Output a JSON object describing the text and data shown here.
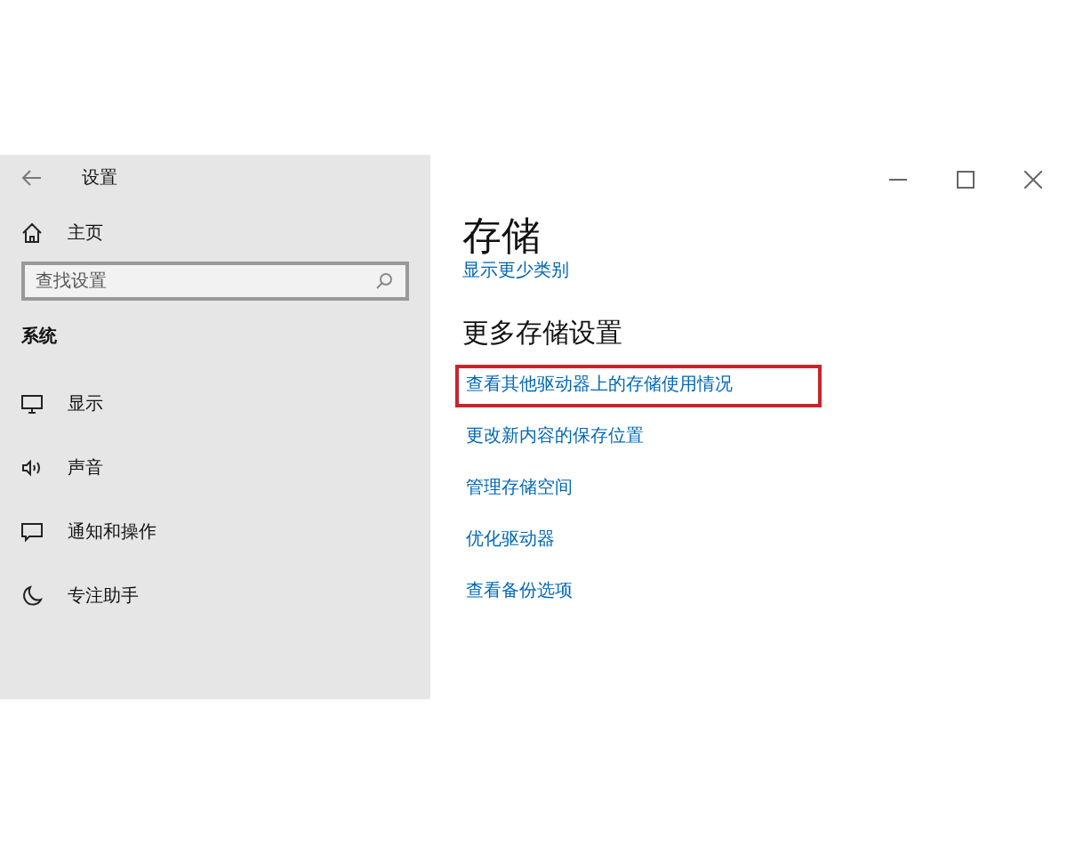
{
  "window": {
    "title": "设置",
    "controls": [
      {
        "kind": "minimize"
      },
      {
        "kind": "maximize"
      },
      {
        "kind": "close"
      }
    ]
  },
  "sidebar": {
    "home": "主页",
    "search": {
      "placeholder": "查找设置"
    },
    "section": "系统",
    "items": [
      {
        "label": "显示",
        "kind": "display",
        "selected": false
      },
      {
        "label": "声音",
        "kind": "sound",
        "selected": false
      },
      {
        "label": "通知和操作",
        "kind": "notification",
        "selected": false
      },
      {
        "label": "专注助手",
        "kind": "moon",
        "selected": false
      }
    ]
  },
  "content": {
    "title": "存储",
    "partial_link": "显示更少类别",
    "section": "更多存储设置",
    "links": [
      {
        "label": "查看其他驱动器上的存储使用情况",
        "highlighted": true
      },
      {
        "label": "更改新内容的保存位置",
        "highlighted": false
      },
      {
        "label": "管理存储空间",
        "highlighted": false
      },
      {
        "label": "优化驱动器",
        "highlighted": false
      },
      {
        "label": "查看备份选项",
        "highlighted": false
      }
    ]
  }
}
